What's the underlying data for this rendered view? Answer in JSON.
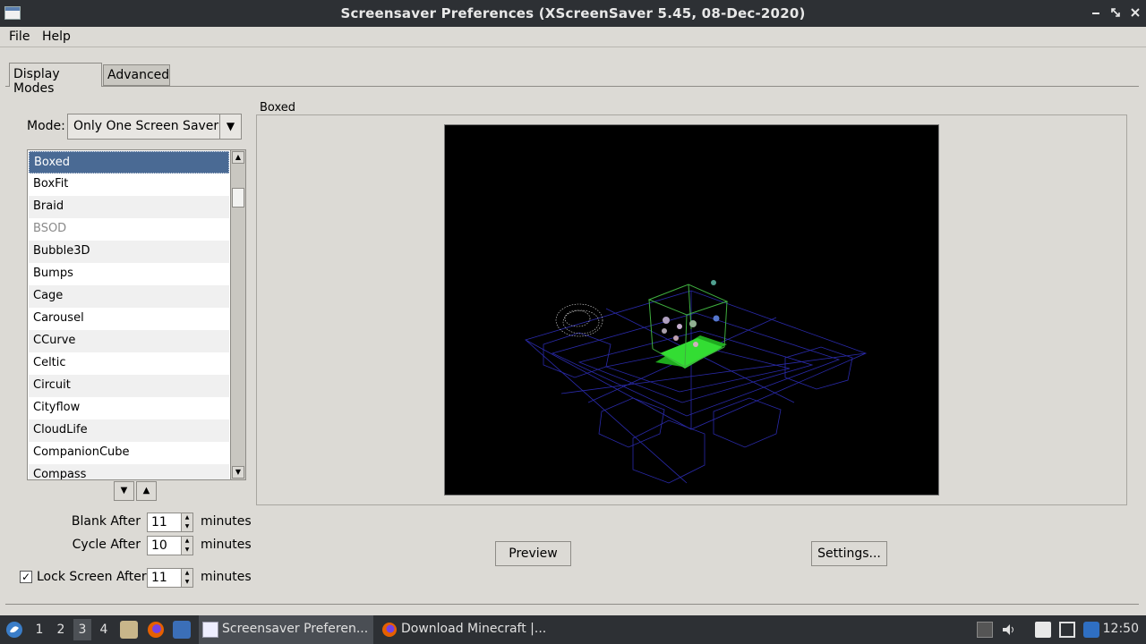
{
  "window": {
    "title": "Screensaver Preferences  (XScreenSaver 5.45, 08-Dec-2020)"
  },
  "window_buttons": {
    "minimize": "–",
    "maximize": "✕",
    "close": "✕"
  },
  "menubar": {
    "file": "File",
    "help": "Help"
  },
  "tabs": {
    "display_modes": "Display Modes",
    "advanced": "Advanced"
  },
  "mode": {
    "label": "Mode:",
    "value": "Only One Screen Saver"
  },
  "savers": {
    "items": [
      "Boxed",
      "BoxFit",
      "Braid",
      "BSOD",
      "Bubble3D",
      "Bumps",
      "Cage",
      "Carousel",
      "CCurve",
      "Celtic",
      "Circuit",
      "Cityflow",
      "CloudLife",
      "CompanionCube",
      "Compass"
    ],
    "selected": "Boxed",
    "disabled": [
      "BSOD"
    ]
  },
  "timing": {
    "blank_label": "Blank After",
    "blank_value": "11",
    "blank_unit": "minutes",
    "cycle_label": "Cycle After",
    "cycle_value": "10",
    "cycle_unit": "minutes",
    "lock_label": "Lock Screen After",
    "lock_value": "11",
    "lock_unit": "minutes",
    "lock_checked": true
  },
  "preview": {
    "frame_label": "Boxed",
    "preview_button": "Preview",
    "settings_button": "Settings..."
  },
  "taskbar": {
    "workspaces": [
      "1",
      "2",
      "3",
      "4"
    ],
    "active_workspace": "3",
    "tasks": [
      "Screensaver Preferen...",
      "Download Minecraft |..."
    ],
    "clock": "12:50"
  },
  "colors": {
    "selection": "#4a6a94",
    "titlebar": "#2d3034",
    "window_bg": "#dcdad5"
  }
}
